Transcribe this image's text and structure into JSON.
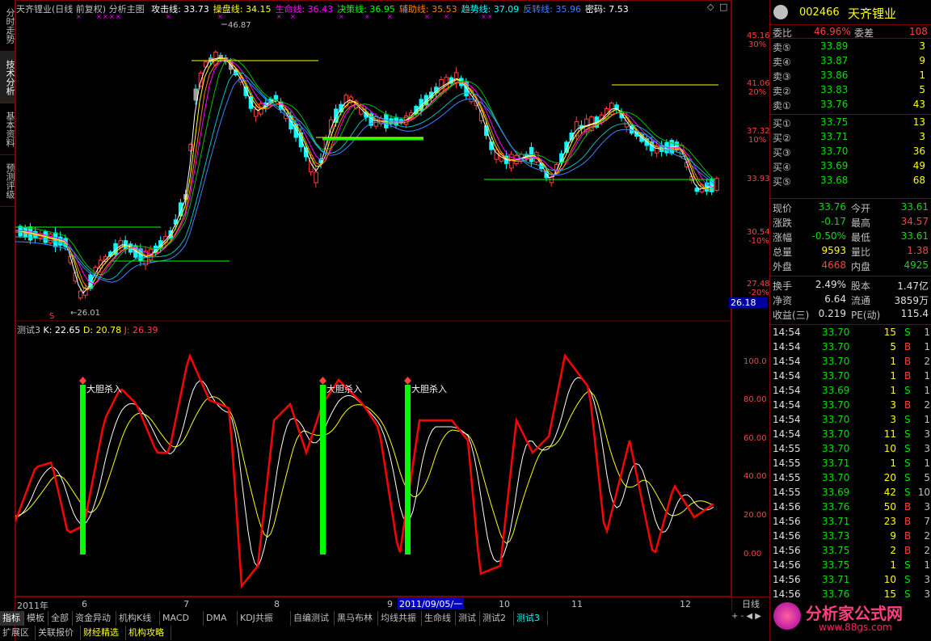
{
  "sidebar": {
    "tabs": [
      "分时走势",
      "技术分析",
      "基本资料",
      "预测评级"
    ]
  },
  "header": {
    "title": "天齐锂业(日线 前复权) 分析主图",
    "indicators": [
      {
        "label": "攻击线:",
        "value": "33.73",
        "color": "#ffffff"
      },
      {
        "label": "操盘线:",
        "value": "34.15",
        "color": "#ffff00"
      },
      {
        "label": "生命线:",
        "value": "36.43",
        "color": "#ff00ff"
      },
      {
        "label": "决策线:",
        "value": "36.95",
        "color": "#00ff00"
      },
      {
        "label": "辅助线:",
        "value": "35.53",
        "color": "#ff8000"
      },
      {
        "label": "趋势线:",
        "value": "37.09",
        "color": "#00ffff"
      },
      {
        "label": "反转线:",
        "value": "35.96",
        "color": "#4080ff"
      },
      {
        "label": "密码:",
        "value": "7.53",
        "color": "#ffffff"
      }
    ]
  },
  "price_chart": {
    "annotations": {
      "high": "46.87",
      "low": "26.01",
      "s_marker": "S",
      "current": "26.18"
    },
    "y_axis": [
      {
        "price": "45.16",
        "pct": "30%"
      },
      {
        "price": "41.06",
        "pct": "20%"
      },
      {
        "price": "37.32",
        "pct": "10%"
      },
      {
        "price": "33.93",
        "pct": ""
      },
      {
        "price": "30.54",
        "pct": "-10%"
      },
      {
        "price": "27.48",
        "pct": "-20%"
      }
    ]
  },
  "indicator": {
    "title": "测试3",
    "k": "K: 22.65",
    "d": "D: 20.78",
    "j": "J: 26.39",
    "buy_label": "大胆杀入",
    "y_axis": [
      "100.0",
      "80.00",
      "60.00",
      "40.00",
      "20.00",
      "0.00"
    ]
  },
  "x_axis": {
    "labels": [
      "2011年",
      "6",
      "7",
      "8",
      "9",
      "10",
      "11",
      "12"
    ],
    "cursor_date": "2011/09/05/一",
    "period": "日线"
  },
  "bottom_tabs": [
    "指标",
    "模板",
    "全部",
    "资金异动",
    "机构K线",
    "MACD",
    "DMA",
    "KDJ共振",
    "自编测试",
    "黑马布林",
    "均线共振",
    "生命线",
    "测试",
    "测试2",
    "测试3"
  ],
  "bottom_tabs2": [
    "扩展区",
    "关联报价",
    "财经精选",
    "机构攻略"
  ],
  "quote": {
    "code": "002466",
    "name": "天齐锂业",
    "weibi_label": "委比",
    "weibi": "46.96%",
    "weicha_label": "委差",
    "weicha": "108",
    "sells": [
      {
        "label": "卖⑤",
        "price": "33.89",
        "vol": "3"
      },
      {
        "label": "卖④",
        "price": "33.87",
        "vol": "9"
      },
      {
        "label": "卖③",
        "price": "33.86",
        "vol": "1"
      },
      {
        "label": "卖②",
        "price": "33.83",
        "vol": "5"
      },
      {
        "label": "卖①",
        "price": "33.76",
        "vol": "43"
      }
    ],
    "buys": [
      {
        "label": "买①",
        "price": "33.75",
        "vol": "13"
      },
      {
        "label": "买②",
        "price": "33.71",
        "vol": "3"
      },
      {
        "label": "买③",
        "price": "33.70",
        "vol": "36"
      },
      {
        "label": "买④",
        "price": "33.69",
        "vol": "49"
      },
      {
        "label": "买⑤",
        "price": "33.68",
        "vol": "68"
      }
    ],
    "stats": [
      {
        "l1": "现价",
        "v1": "33.76",
        "c1": "#00e000",
        "l2": "今开",
        "v2": "33.61",
        "c2": "#00e000"
      },
      {
        "l1": "涨跌",
        "v1": "-0.17",
        "c1": "#00e000",
        "l2": "最高",
        "v2": "34.57",
        "c2": "#ff4040"
      },
      {
        "l1": "涨幅",
        "v1": "-0.50%",
        "c1": "#00e000",
        "l2": "最低",
        "v2": "33.61",
        "c2": "#00e000"
      },
      {
        "l1": "总量",
        "v1": "9593",
        "c1": "#ffff00",
        "l2": "量比",
        "v2": "1.38",
        "c2": "#ff4040"
      },
      {
        "l1": "外盘",
        "v1": "4668",
        "c1": "#ff4040",
        "l2": "内盘",
        "v2": "4925",
        "c2": "#00e000"
      }
    ],
    "stats2": [
      {
        "l1": "换手",
        "v1": "2.49%",
        "l2": "股本",
        "v2": "1.47亿"
      },
      {
        "l1": "净资",
        "v1": "6.64",
        "l2": "流通",
        "v2": "3859万"
      },
      {
        "l1": "收益(三)",
        "v1": "0.219",
        "l2": "PE(动)",
        "v2": "115.4"
      }
    ],
    "ticks": [
      {
        "t": "14:54",
        "p": "33.70",
        "v": "15",
        "s": "S",
        "n": "1"
      },
      {
        "t": "14:54",
        "p": "33.70",
        "v": "5",
        "s": "B",
        "n": "1"
      },
      {
        "t": "14:54",
        "p": "33.70",
        "v": "1",
        "s": "B",
        "n": "2"
      },
      {
        "t": "14:54",
        "p": "33.70",
        "v": "1",
        "s": "B",
        "n": "1"
      },
      {
        "t": "14:54",
        "p": "33.69",
        "v": "1",
        "s": "S",
        "n": "1"
      },
      {
        "t": "14:54",
        "p": "33.70",
        "v": "3",
        "s": "B",
        "n": "2"
      },
      {
        "t": "14:54",
        "p": "33.70",
        "v": "3",
        "s": "S",
        "n": "1"
      },
      {
        "t": "14:54",
        "p": "33.70",
        "v": "11",
        "s": "S",
        "n": "3"
      },
      {
        "t": "14:55",
        "p": "33.70",
        "v": "10",
        "s": "S",
        "n": "3"
      },
      {
        "t": "14:55",
        "p": "33.71",
        "v": "1",
        "s": "S",
        "n": "1"
      },
      {
        "t": "14:55",
        "p": "33.70",
        "v": "20",
        "s": "S",
        "n": "5"
      },
      {
        "t": "14:55",
        "p": "33.69",
        "v": "42",
        "s": "S",
        "n": "10"
      },
      {
        "t": "14:56",
        "p": "33.76",
        "v": "50",
        "s": "B",
        "n": "3"
      },
      {
        "t": "14:56",
        "p": "33.71",
        "v": "23",
        "s": "B",
        "n": "7"
      },
      {
        "t": "14:56",
        "p": "33.73",
        "v": "9",
        "s": "B",
        "n": "2"
      },
      {
        "t": "14:56",
        "p": "33.75",
        "v": "2",
        "s": "B",
        "n": "2"
      },
      {
        "t": "14:56",
        "p": "33.75",
        "v": "1",
        "s": "S",
        "n": "1"
      },
      {
        "t": "14:56",
        "p": "33.71",
        "v": "10",
        "s": "S",
        "n": "3"
      },
      {
        "t": "14:56",
        "p": "33.76",
        "v": "15",
        "s": "S",
        "n": "3"
      }
    ]
  },
  "watermark": {
    "text": "分析家公式网",
    "url": "www.88gs.com"
  },
  "colors": {
    "up": "#ff4040",
    "down": "#00ffff",
    "grid": "#800000",
    "buy_bar": "#00ff00",
    "j_line": "#ff0000"
  }
}
